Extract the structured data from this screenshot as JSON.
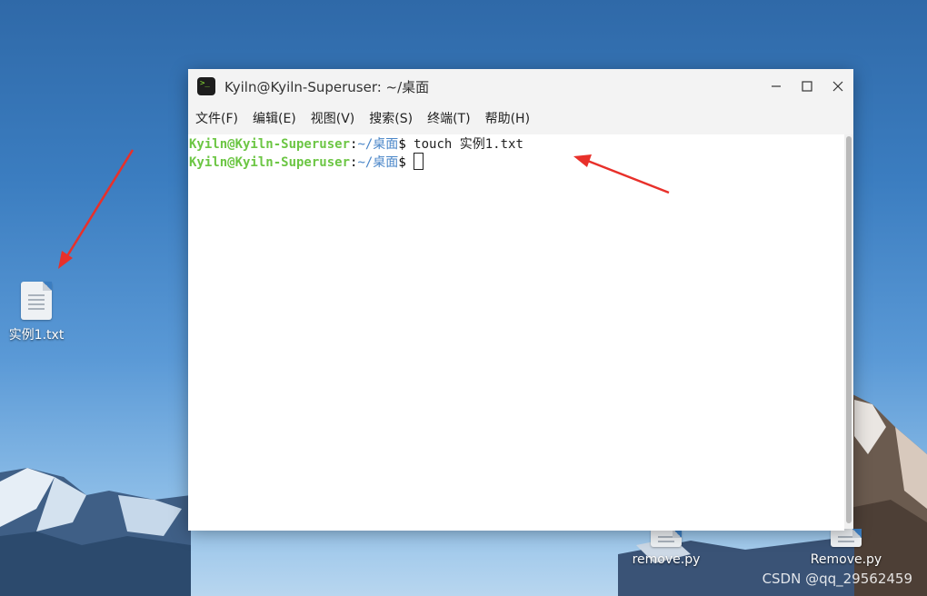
{
  "window": {
    "title": "Kyiln@Kyiln-Superuser: ~/桌面",
    "app_icon": "terminal-icon"
  },
  "menu": [
    {
      "label": "文件(F)"
    },
    {
      "label": "编辑(E)"
    },
    {
      "label": "视图(V)"
    },
    {
      "label": "搜索(S)"
    },
    {
      "label": "终端(T)"
    },
    {
      "label": "帮助(H)"
    }
  ],
  "terminal": {
    "lines": [
      {
        "user": "Kyiln@Kyiln-Superuser",
        "sep": ":",
        "path": "~/桌面",
        "prompt": "$",
        "command": " touch 实例1.txt"
      },
      {
        "user": "Kyiln@Kyiln-Superuser",
        "sep": ":",
        "path": "~/桌面",
        "prompt": "$",
        "command": " "
      }
    ]
  },
  "desktop": {
    "icons": [
      {
        "label": "实例1.txt",
        "icon": "text-file-icon"
      },
      {
        "label": "remove.py",
        "icon": "python-file-icon"
      },
      {
        "label": "Remove.py",
        "icon": "python-file-icon"
      }
    ]
  },
  "watermark": "CSDN @qq_29562459",
  "colors": {
    "user": "#6cc644",
    "path": "#4a86c8",
    "annotation_arrow": "#e8302a"
  }
}
